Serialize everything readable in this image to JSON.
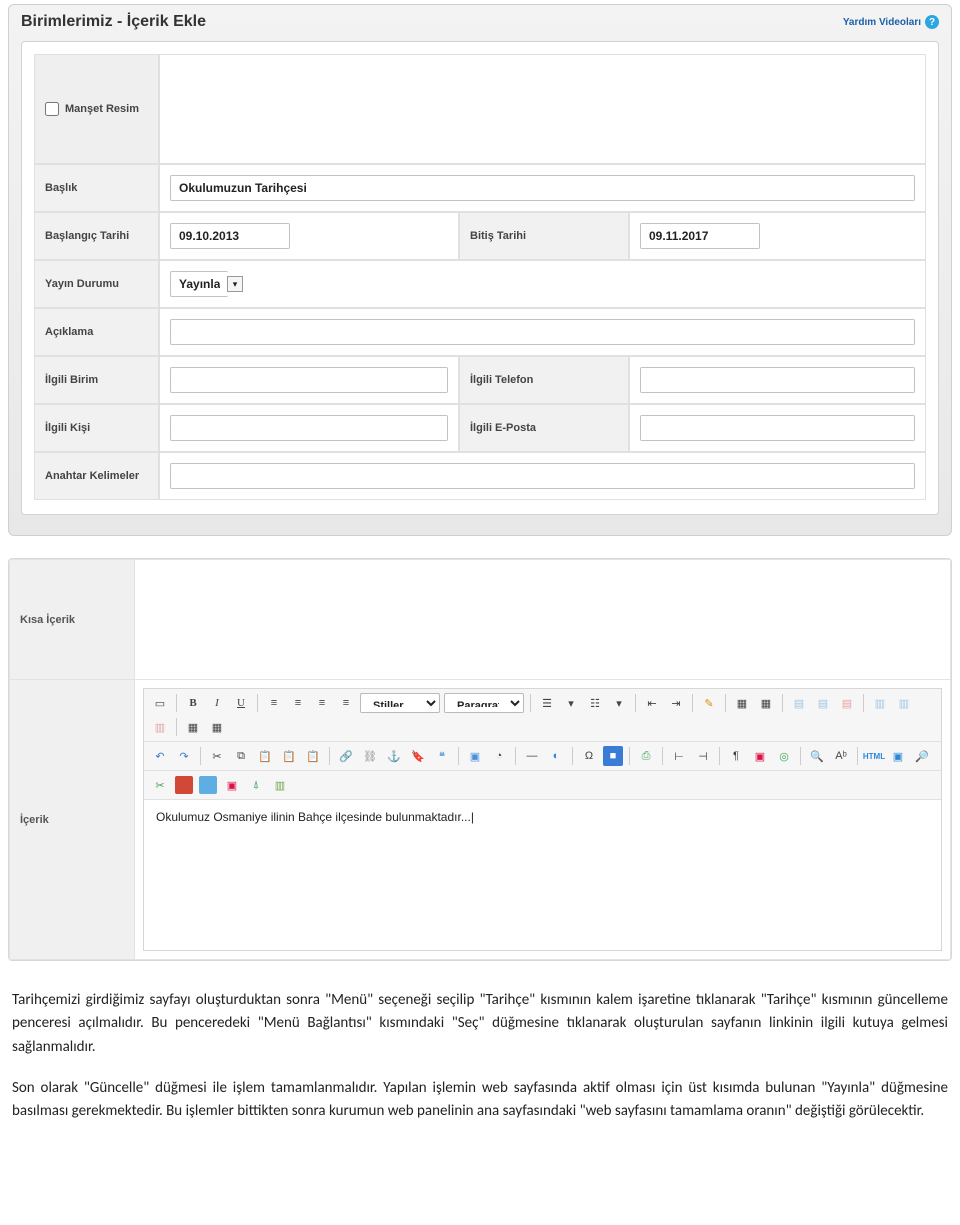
{
  "header": {
    "title": "Birimlerimiz - İçerik Ekle",
    "help": "Yardım Videoları"
  },
  "form": {
    "manset_label": "Manşet Resim",
    "baslik_label": "Başlık",
    "baslik_value": "Okulumuzun Tarihçesi",
    "start_label": "Başlangıç Tarihi",
    "start_value": "09.10.2013",
    "end_label": "Bitiş Tarihi",
    "end_value": "09.11.2017",
    "yayin_label": "Yayın Durumu",
    "yayin_value": "Yayınla",
    "aciklama_label": "Açıklama",
    "birim_label": "İlgili Birim",
    "telefon_label": "İlgili Telefon",
    "kisi_label": "İlgili Kişi",
    "eposta_label": "İlgili E-Posta",
    "anahtar_label": "Anahtar Kelimeler",
    "kisa_label": "Kısa İçerik",
    "icerik_label": "İçerik"
  },
  "editor": {
    "styles_label": "Stiller",
    "format_label": "Paragraf",
    "html_label": "HTML",
    "content": "Okulumuz Osmaniye ilinin Bahçe ilçesinde bulunmaktadır...|"
  },
  "doc": {
    "p1": "Tarihçemizi girdiğimiz sayfayı oluşturduktan sonra \"Menü\" seçeneği seçilip \"Tarihçe\" kısmının kalem işaretine tıklanarak \"Tarihçe\" kısmının güncelleme penceresi açılmalıdır. Bu penceredeki \"Menü Bağlantısı\" kısmındaki \"Seç\" düğmesine tıklanarak oluşturulan sayfanın linkinin ilgili kutuya gelmesi sağlanmalıdır.",
    "p2": "Son olarak \"Güncelle\" düğmesi ile işlem tamamlanmalıdır. Yapılan işlemin web sayfasında aktif olması için üst kısımda bulunan \"Yayınla\" düğmesine basılması gerekmektedir. Bu işlemler bittikten sonra kurumun web panelinin ana sayfasındaki \"web sayfasını tamamlama oranın\" değiştiği görülecektir."
  }
}
